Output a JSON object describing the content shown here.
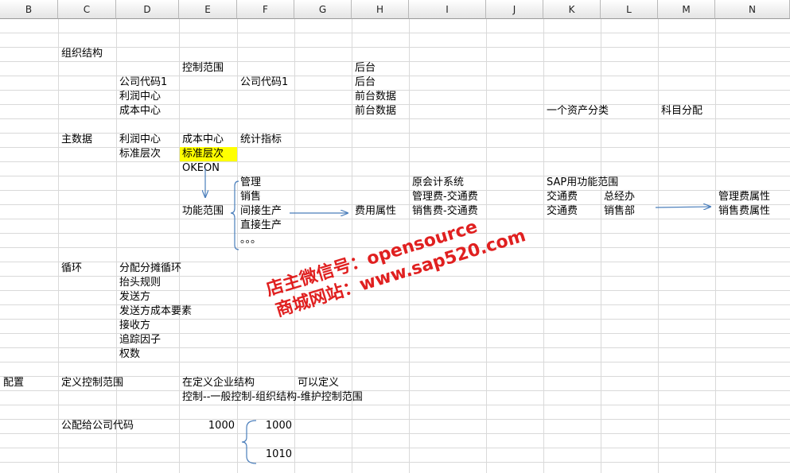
{
  "columns": [
    "B",
    "C",
    "D",
    "E",
    "F",
    "G",
    "H",
    "I",
    "J",
    "K",
    "L",
    "M",
    "N"
  ],
  "cells": {
    "c1": "组织结构",
    "c2": "控制范围",
    "c3": "后台",
    "c4": "公司代码1",
    "c5": "公司代码1",
    "c6": "后台",
    "c7": "利润中心",
    "c8": "前台数据",
    "c9": "成本中心",
    "c10": "前台数据",
    "c11": "一个资产分类",
    "c12": "科目分配",
    "c13": "主数据",
    "c14": "利润中心",
    "c15": "成本中心",
    "c16": "统计指标",
    "c17": "标准层次",
    "c18": "标准层次",
    "c19": "OKEON",
    "c20": "管理",
    "c21": "原会计系统",
    "c22": "SAP用功能范围",
    "c23": "销售",
    "c24": "管理费-交通费",
    "c25": "交通费",
    "c26": "总经办",
    "c27": "管理费属性",
    "c28": "功能范围",
    "c29": "间接生产",
    "c30": "费用属性",
    "c31": "销售费-交通费",
    "c32": "交通费",
    "c33": "销售部",
    "c34": "销售费属性",
    "c35": "直接生产",
    "c36": "。。。",
    "c37": "循环",
    "c38": "分配分摊循环",
    "c39": "抬头规则",
    "c40": "发送方",
    "c41": "发送方成本要素",
    "c42": "接收方",
    "c43": "追踪因子",
    "c44": "权数",
    "c45": "配置",
    "c46": "定义控制范围",
    "c47": "在定义企业结构",
    "c48": "可以定义",
    "c49": "控制--一般控制-组织结构-维护控制范围",
    "c50": "公配给公司代码",
    "c51": "1000",
    "c52": "1000",
    "c53": "1010"
  },
  "watermark": {
    "line1": "店主微信号：opensource",
    "line2": "商城网站：www.sap520.com"
  },
  "colors": {
    "highlight": "#ffff00",
    "arrow": "#4a7ebb",
    "watermark": "#e02020"
  }
}
